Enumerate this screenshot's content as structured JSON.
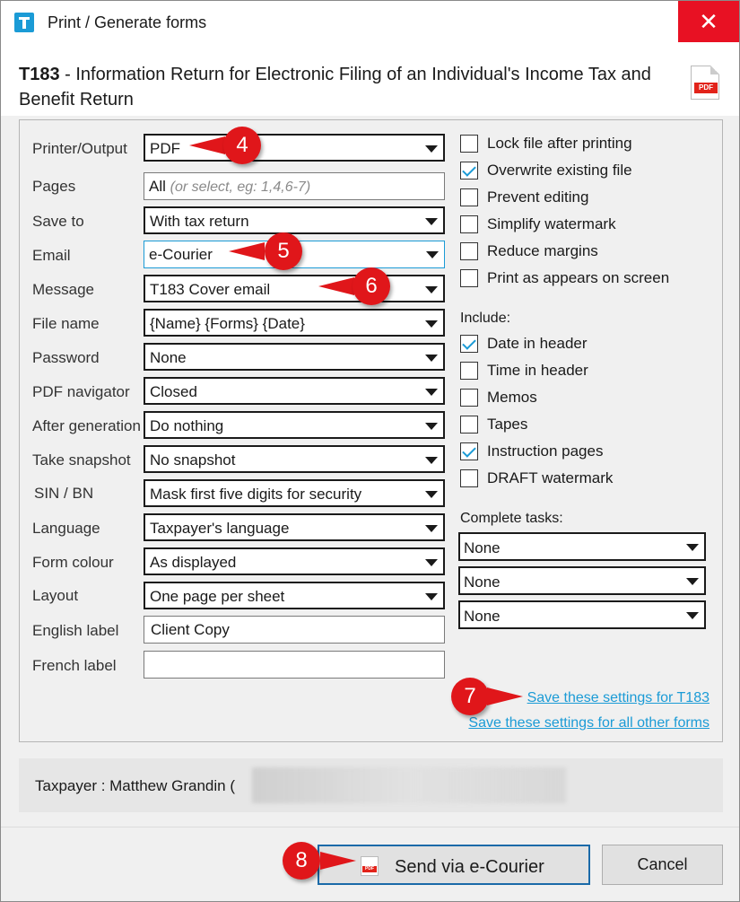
{
  "window": {
    "title": "Print / Generate forms",
    "close_symbol": "✕"
  },
  "heading": {
    "form_code": "T183",
    "form_title": " - Information Return for Electronic Filing of an Individual's Income Tax and Benefit Return",
    "pdf_badge": "PDF"
  },
  "fields": {
    "printer_label": "Printer/Output",
    "printer_value": "PDF",
    "pages_label": "Pages",
    "pages_value": "All",
    "pages_hint": "(or select, eg: 1,4,6-7)",
    "saveto_label": "Save to",
    "saveto_value": "With tax return",
    "email_label": "Email",
    "email_value": "e-Courier",
    "message_label": "Message",
    "message_value": "T183 Cover email",
    "filename_label": "File name",
    "filename_value": "{Name} {Forms} {Date}",
    "password_label": "Password",
    "password_value": "None",
    "pdfnav_label": "PDF navigator",
    "pdfnav_value": "Closed",
    "aftergen_label": "After generation",
    "aftergen_value": "Do nothing",
    "snapshot_label": "Take snapshot",
    "snapshot_value": "No snapshot",
    "sin_label": "SIN / BN",
    "sin_value": "Mask first five digits for security",
    "language_label": "Language",
    "language_value": "Taxpayer's language",
    "colour_label": "Form colour",
    "colour_value": "As displayed",
    "layout_label": "Layout",
    "layout_value": "One page per sheet",
    "english_label": "English label",
    "english_value": "Client Copy",
    "french_label": "French label",
    "french_value": ""
  },
  "options": [
    {
      "label": "Lock file after printing",
      "checked": false
    },
    {
      "label": "Overwrite existing file",
      "checked": true
    },
    {
      "label": "Prevent editing",
      "checked": false
    },
    {
      "label": "Simplify watermark",
      "checked": false
    },
    {
      "label": "Reduce margins",
      "checked": false
    },
    {
      "label": "Print as appears on screen",
      "checked": false
    }
  ],
  "include": {
    "label": "Include:",
    "items": [
      {
        "label": "Date in header",
        "checked": true
      },
      {
        "label": "Time in header",
        "checked": false
      },
      {
        "label": "Memos",
        "checked": false
      },
      {
        "label": "Tapes",
        "checked": false
      },
      {
        "label": "Instruction pages",
        "checked": true
      },
      {
        "label": "DRAFT watermark",
        "checked": false
      }
    ]
  },
  "tasks": {
    "label": "Complete tasks:",
    "values": [
      "None",
      "None",
      "None"
    ]
  },
  "links": {
    "save_this": "Save these settings for T183",
    "save_all": "Save these settings for all other forms"
  },
  "taxpayer": {
    "text": "Taxpayer  :  Matthew Grandin ("
  },
  "buttons": {
    "send": "Send via e-Courier",
    "cancel": "Cancel"
  },
  "callouts": [
    "4",
    "5",
    "6",
    "7",
    "8"
  ],
  "colors": {
    "accent": "#1b9bd6",
    "close": "#e81123",
    "callout": "#e0161a"
  }
}
